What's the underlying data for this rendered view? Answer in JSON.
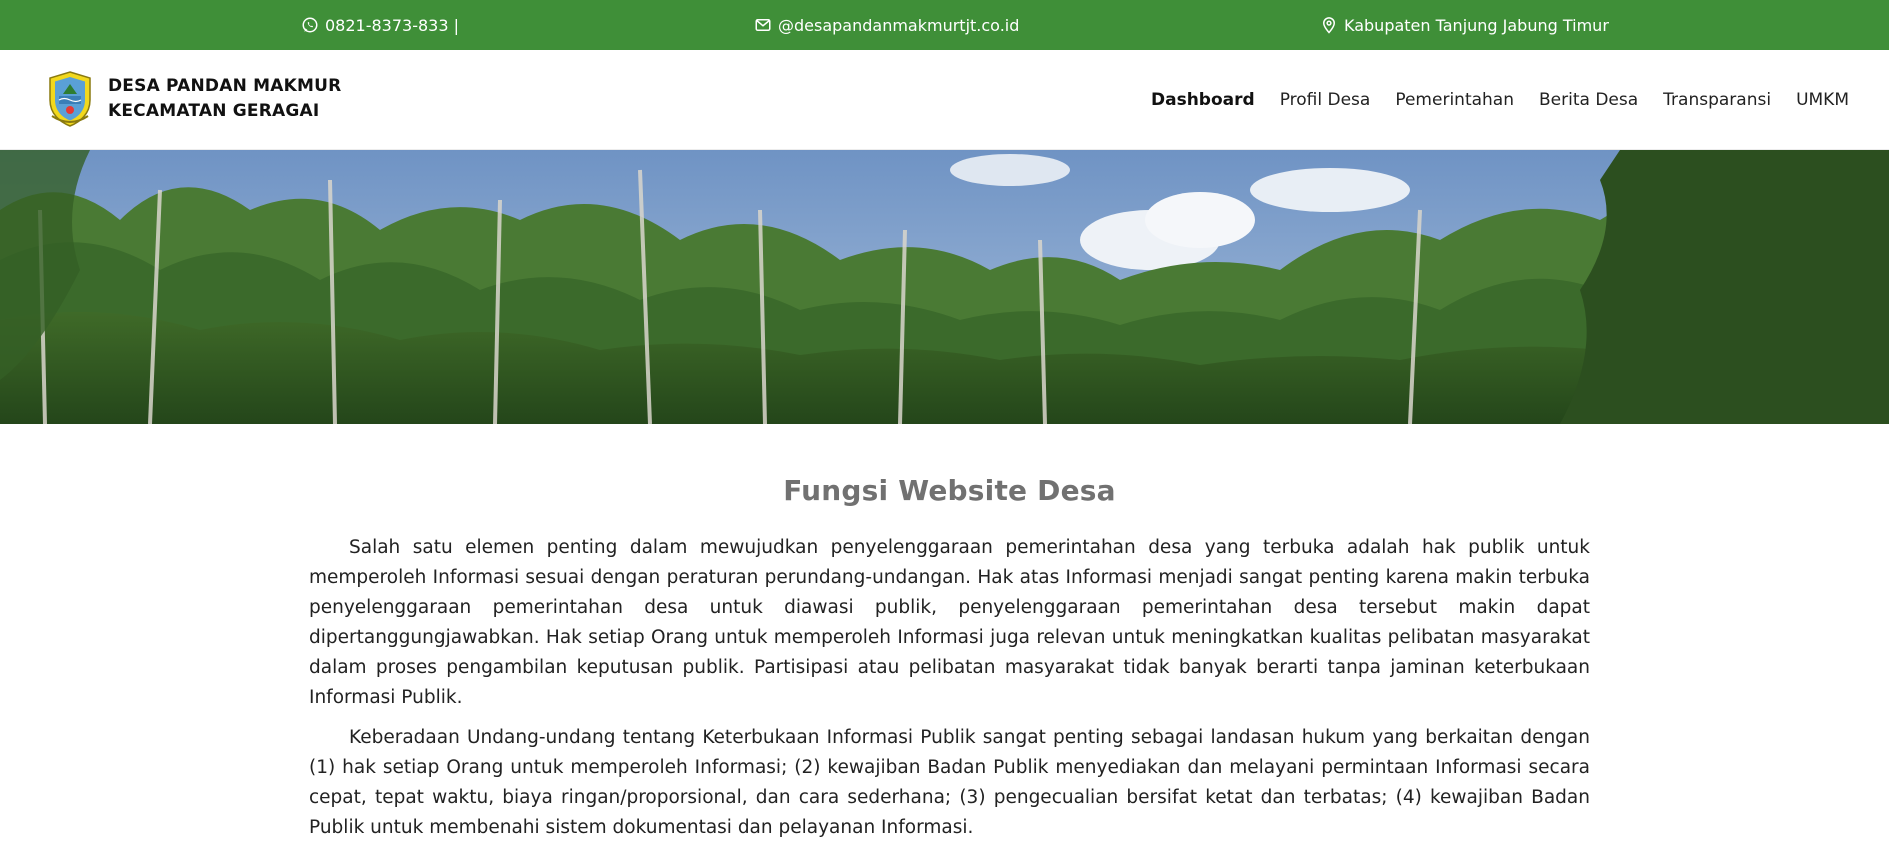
{
  "topbar": {
    "phone": "0821-8373-833 |",
    "email": "@desapandanmakmurtjt.co.id",
    "location": "Kabupaten Tanjung Jabung Timur",
    "background_color": "#3f8f38",
    "icons": [
      "whatsapp-icon",
      "mail-icon",
      "map-pin-icon"
    ]
  },
  "header": {
    "brand_line1": "DESA PANDAN MAKMUR",
    "brand_line2": "KECAMATAN GERAGAI",
    "logo_icon": "regency-emblem-icon"
  },
  "nav": {
    "items": [
      "Dashboard",
      "Profil Desa",
      "Pemerintahan",
      "Berita Desa",
      "Transparansi",
      "UMKM"
    ],
    "active": "Dashboard"
  },
  "hero": {
    "image": "forest-trees-under-blue-sky"
  },
  "main": {
    "heading": "Fungsi Website Desa",
    "paragraphs": [
      "Salah satu elemen penting dalam mewujudkan penyelenggaraan pemerintahan desa yang terbuka adalah hak publik untuk memperoleh Informasi sesuai dengan peraturan perundang-undangan. Hak atas Informasi menjadi sangat penting karena makin terbuka penyelenggaraan pemerintahan desa untuk diawasi publik, penyelenggaraan pemerintahan desa tersebut makin dapat dipertanggungjawabkan. Hak setiap Orang untuk memperoleh Informasi juga relevan untuk meningkatkan kualitas pelibatan masyarakat dalam proses pengambilan keputusan publik. Partisipasi atau pelibatan masyarakat tidak banyak berarti tanpa jaminan keterbukaan Informasi Publik.",
      "Keberadaan Undang-undang tentang Keterbukaan Informasi Publik sangat penting sebagai landasan hukum yang berkaitan dengan (1) hak setiap Orang untuk memperoleh Informasi; (2) kewajiban Badan Publik menyediakan dan melayani permintaan Informasi secara cepat, tepat waktu, biaya ringan/proporsional, dan cara sederhana; (3) pengecualian bersifat ketat dan terbatas; (4) kewajiban Badan Publik untuk membenahi sistem dokumentasi dan pelayanan Informasi."
    ]
  }
}
